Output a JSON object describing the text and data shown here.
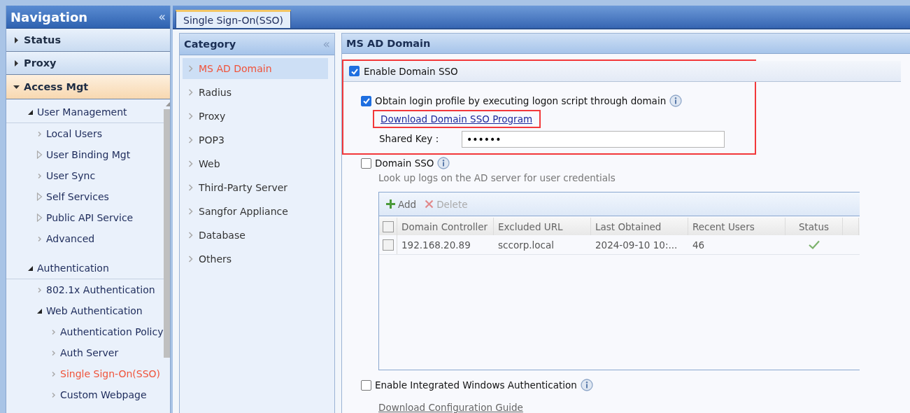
{
  "navigation": {
    "title": "Navigation",
    "collapse_icon": "«",
    "sections": [
      {
        "label": "Status",
        "expanded": false
      },
      {
        "label": "Proxy",
        "expanded": false
      },
      {
        "label": "Access Mgt",
        "expanded": true
      }
    ],
    "tree": [
      {
        "label": "User Management",
        "expanded": true,
        "selected": false,
        "children": [
          {
            "label": "Local Users",
            "selected": false
          },
          {
            "label": "User Binding Mgt",
            "expanded": false,
            "selected": false
          },
          {
            "label": "User Sync",
            "selected": false
          },
          {
            "label": "Self Services",
            "expanded": false,
            "selected": false
          },
          {
            "label": "Public API Service",
            "expanded": false,
            "selected": false
          },
          {
            "label": "Advanced",
            "selected": false
          }
        ]
      },
      {
        "label": "Authentication",
        "expanded": true,
        "selected": false,
        "children": [
          {
            "label": "802.1x Authentication",
            "selected": false
          },
          {
            "label": "Web Authentication",
            "expanded": true,
            "selected": false,
            "children": [
              {
                "label": "Authentication Policy",
                "selected": false
              },
              {
                "label": "Auth Server",
                "selected": false
              },
              {
                "label": "Single Sign-On(SSO)",
                "selected": true
              },
              {
                "label": "Custom Webpage",
                "selected": false
              }
            ]
          }
        ]
      }
    ]
  },
  "tabs": [
    {
      "label": "Single Sign-On(SSO)",
      "selected": true
    }
  ],
  "category": {
    "title": "Category",
    "collapse_icon": "«",
    "items": [
      {
        "label": "MS AD Domain",
        "selected": true
      },
      {
        "label": "Radius",
        "selected": false
      },
      {
        "label": "Proxy",
        "selected": false
      },
      {
        "label": "POP3",
        "selected": false
      },
      {
        "label": "Web",
        "selected": false
      },
      {
        "label": "Third-Party Server",
        "selected": false
      },
      {
        "label": "Sangfor Appliance",
        "selected": false
      },
      {
        "label": "Database",
        "selected": false
      },
      {
        "label": "Others",
        "selected": false
      }
    ]
  },
  "panel": {
    "title": "MS AD Domain",
    "enable_domain_sso": {
      "label": "Enable Domain SSO",
      "checked": true
    },
    "obtain_profile": {
      "label": "Obtain login profile by executing logon script through domain",
      "checked": true
    },
    "download_link": "Download Domain SSO Program",
    "shared_key": {
      "label": "Shared Key：",
      "value": "••••••"
    },
    "domain_sso": {
      "label": "Domain SSO",
      "checked": false,
      "description": "Look up logs on the AD server for user credentials"
    },
    "toolbar": [
      {
        "label": "Add",
        "kind": "add",
        "disabled": false
      },
      {
        "label": "Delete",
        "kind": "delete",
        "disabled": true
      }
    ],
    "table": {
      "select_all_checked": false,
      "columns": [
        "Domain Controller",
        "Excluded URL",
        "Last Obtained",
        "Recent Users",
        "Status"
      ],
      "rows": [
        {
          "checked": false,
          "cells": [
            "192.168.20.89",
            "sccorp.local",
            "2024-09-10 10:...",
            "46"
          ],
          "status_ok": true
        }
      ]
    },
    "integrated_windows_auth": {
      "label": "Enable Integrated Windows Authentication",
      "checked": false
    },
    "guide_link": "Download Configuration Guide"
  }
}
